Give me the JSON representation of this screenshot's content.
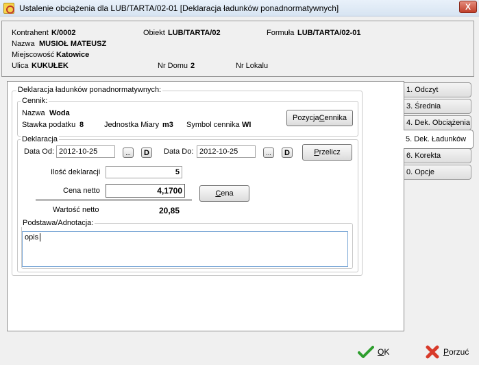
{
  "window": {
    "title": "Ustalenie obciążenia dla LUB/TARTA/02-01   [Deklaracja ładunków ponadnormatywnych]",
    "close_label": "X"
  },
  "header": {
    "kontrahent_label": "Kontrahent",
    "kontrahent_value": "K/0002",
    "obiekt_label": "Obiekt",
    "obiekt_value": "LUB/TARTA/02",
    "formula_label": "Formuła",
    "formula_value": "LUB/TARTA/02-01",
    "nazwa_label": "Nazwa",
    "nazwa_value": "MUSIOŁ MATEUSZ",
    "miejscowosc_label": "Miejscowość",
    "miejscowosc_value": "Katowice",
    "ulica_label": "Ulica",
    "ulica_value": "KUKUŁEK",
    "nr_domu_label": "Nr Domu",
    "nr_domu_value": "2",
    "nr_lokalu_label": "Nr Lokalu",
    "nr_lokalu_value": ""
  },
  "declaration": {
    "group_title": "Deklaracja ładunków ponadnormatywnych:",
    "cennik": {
      "title": "Cennik:",
      "nazwa_label": "Nazwa",
      "nazwa_value": "Woda",
      "stawka_label": "Stawka podatku",
      "stawka_value": "8",
      "jednostka_label": "Jednostka Miary",
      "jednostka_value": "m3",
      "symbol_label": "Symbol cennika",
      "symbol_value": "WI",
      "pozycja_button_pre": "Pozycja ",
      "pozycja_button_key": "C",
      "pozycja_button_post": "ennika"
    },
    "deklaracja": {
      "title": "Deklaracja",
      "data_od_label": "Data Od:",
      "data_od_value": "2012-10-25",
      "data_do_label": "Data Do:",
      "data_do_value": "2012-10-25",
      "ellipsis_label": "...",
      "d_label": "D",
      "przelicz_key": "P",
      "przelicz_rest": "rzelicz",
      "ilosc_label": "Ilość deklaracji",
      "ilosc_value": "5",
      "cena_label": "Cena netto",
      "cena_value": "4,1700",
      "cena_button_key": "C",
      "cena_button_rest": "ena",
      "wartosc_label": "Wartość netto",
      "wartosc_value": "20,85"
    },
    "podstawa": {
      "title": "Podstawa/Adnotacja:",
      "value": "opis"
    }
  },
  "tabs": [
    {
      "label": "1. Odczyt"
    },
    {
      "label": "3. Średnia"
    },
    {
      "label": "4. Dek. Obciążenia"
    },
    {
      "label": "5. Dek. Ładunków"
    },
    {
      "label": "6. Korekta"
    },
    {
      "label": "0. Opcje"
    }
  ],
  "footer": {
    "ok_key": "O",
    "ok_rest": "K",
    "porzuc_key": "P",
    "porzuc_rest": "orzuć",
    "ok_color": "#2e9e2e",
    "porzuc_color": "#d83a2a"
  }
}
